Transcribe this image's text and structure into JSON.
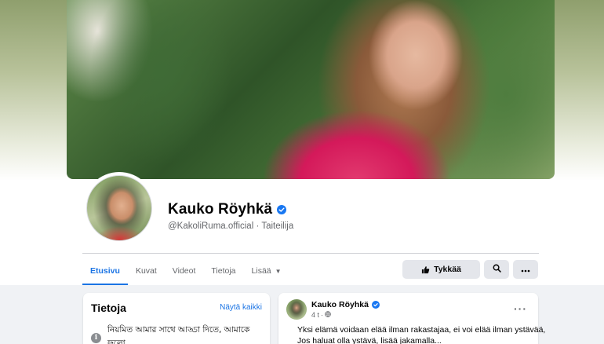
{
  "profile": {
    "name": "Kauko Röyhkä",
    "handle": "@KakoliRuma.official",
    "separator": "·",
    "category": "Taiteilija",
    "verified_color": "#1877f2"
  },
  "tabs": [
    {
      "label": "Etusivu",
      "active": true
    },
    {
      "label": "Kuvat",
      "active": false
    },
    {
      "label": "Videot",
      "active": false
    },
    {
      "label": "Tietoja",
      "active": false
    },
    {
      "label": "Lisää",
      "active": false,
      "icon": "caret-down-icon"
    }
  ],
  "actions": {
    "like_label": "Tykkää",
    "like_icon": "thumbs-up-icon",
    "search_icon": "search-icon",
    "more_icon": "more-horizontal-icon"
  },
  "about": {
    "title": "Tietoja",
    "see_all": "Näytä kaikki",
    "info_text": "নিয়মিত আমার সাথে আড্ডা দিতে, আমাকে ফলো"
  },
  "post": {
    "author": "Kauko Röyhkä",
    "time": "4 t",
    "dot": "·",
    "audience_icon": "globe-icon",
    "more": "···",
    "lines": [
      "Yksi elämä voidaan elää ilman rakastajaa, ei voi elää ilman ystävää,",
      "Jos haluat olla ystävä, lisää jakamalla..."
    ]
  },
  "colors": {
    "accent": "#1b74e4",
    "secondary_text": "#65676b",
    "button_bg": "#e4e6eb",
    "page_bg": "#f0f2f5"
  }
}
